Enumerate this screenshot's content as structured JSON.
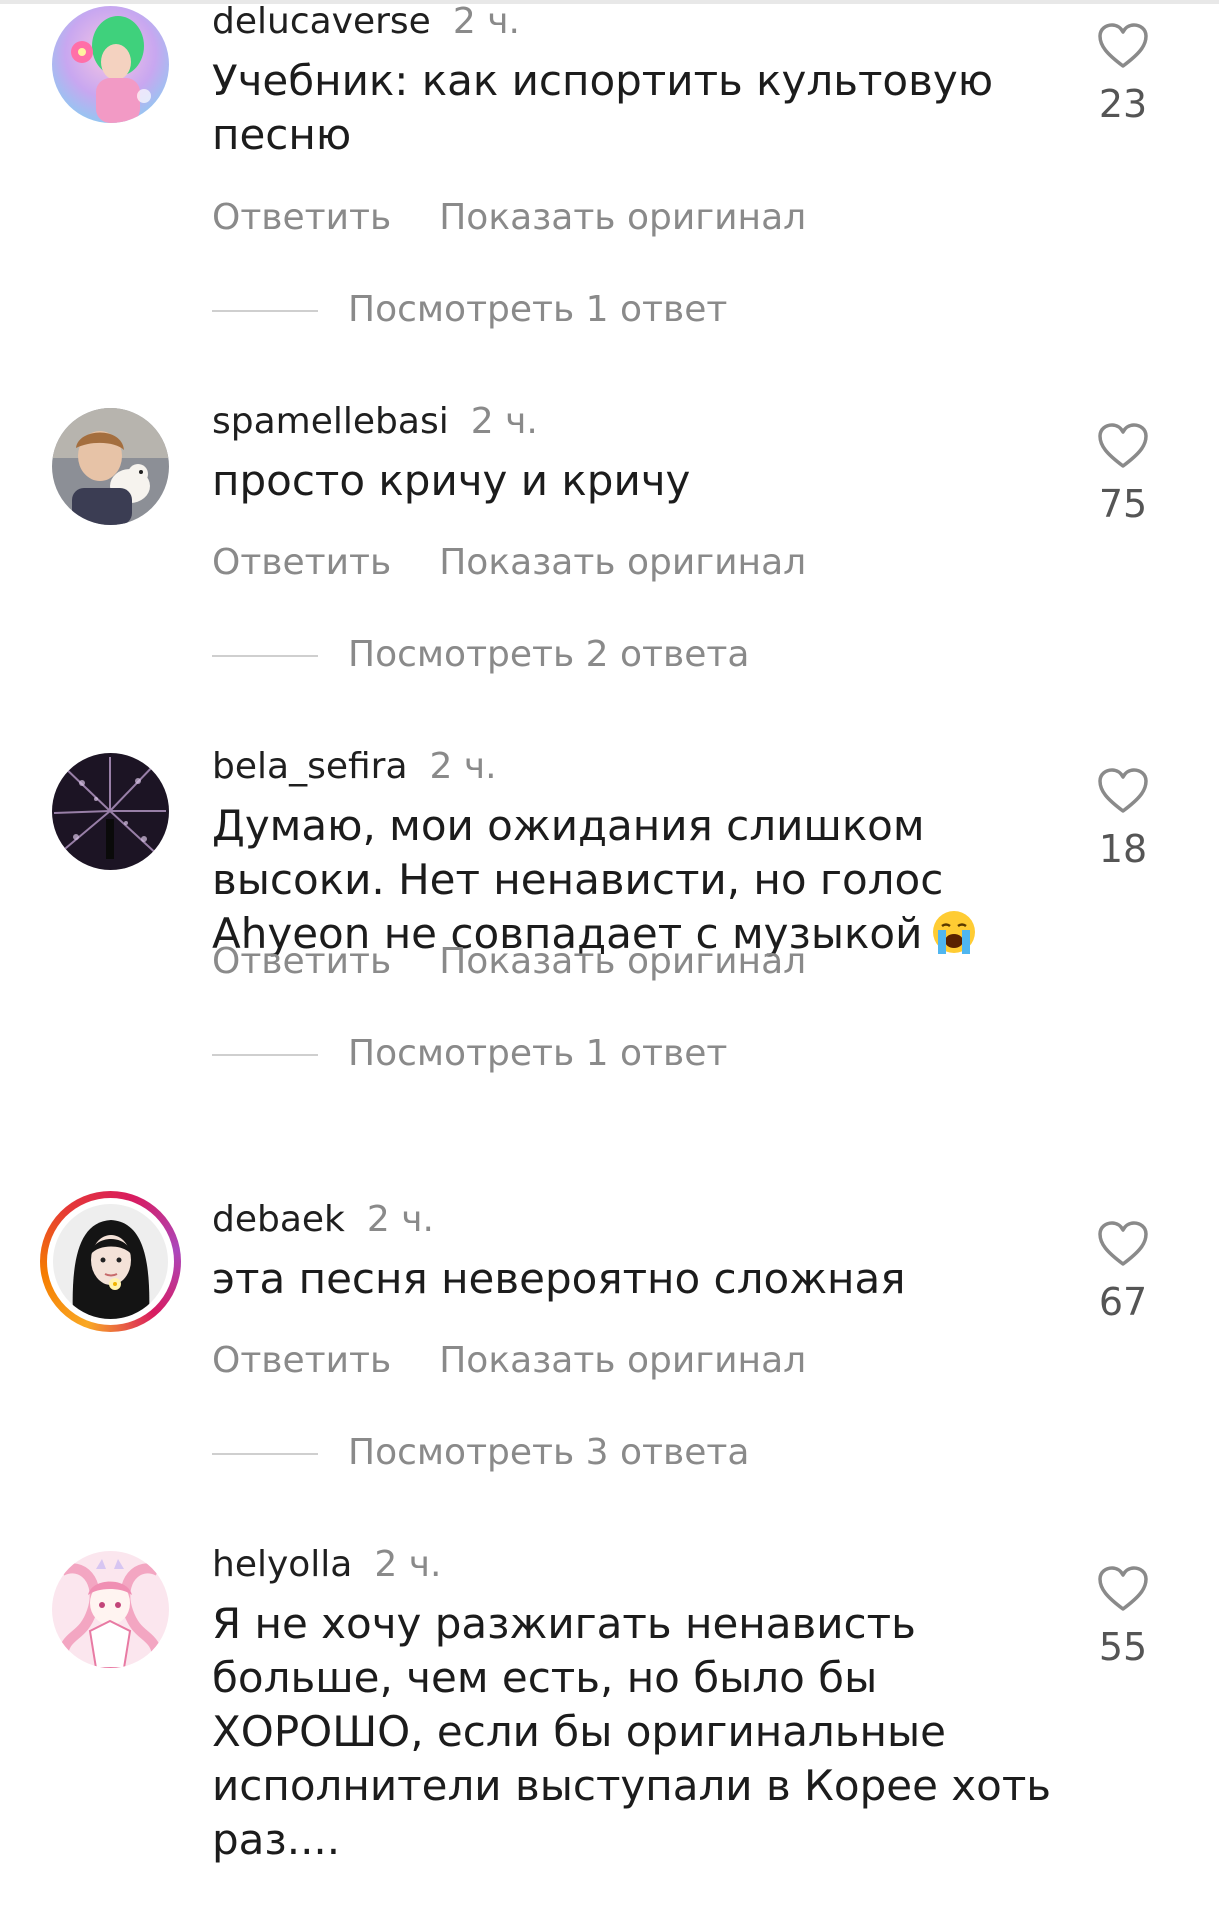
{
  "labels": {
    "reply": "Ответить",
    "show_original": "Показать оригинал"
  },
  "comments": [
    {
      "username": "delucaverse",
      "time": "2 ч.",
      "text": "Учебник: как испортить культовую песню",
      "likes": "23",
      "replies_label": "Посмотреть 1 ответ"
    },
    {
      "username": "spamellebasi",
      "time": "2 ч.",
      "text": "просто кричу и кричу",
      "likes": "75",
      "replies_label": "Посмотреть 2 ответа"
    },
    {
      "username": "bela_sefira",
      "time": "2 ч.",
      "text": "Думаю, мои ожидания слишком высоки. Нет ненависти, но голос Ahyeon не совпадает с музыкой",
      "emoji": "loudly-crying-face",
      "likes": "18",
      "replies_label": "Посмотреть 1 ответ"
    },
    {
      "username": "debaek",
      "time": "2 ч.",
      "text": "эта песня невероятно сложная",
      "likes": "67",
      "replies_label": "Посмотреть 3 ответа",
      "has_story_ring": true
    },
    {
      "username": "helyolla",
      "time": "2 ч.",
      "text": "Я не хочу разжигать ненависть больше, чем есть, но было бы ХОРОШО, если бы оригинальные исполнители выступали в Корее хоть раз....",
      "likes": "55"
    }
  ],
  "icons": {
    "like": "heart-outline-icon",
    "emoji": "loudly-crying-face"
  },
  "colors": {
    "text": "#1c1c1c",
    "muted": "#8a8a8a",
    "like_count": "#555555",
    "story_ring": "#d81b60"
  }
}
